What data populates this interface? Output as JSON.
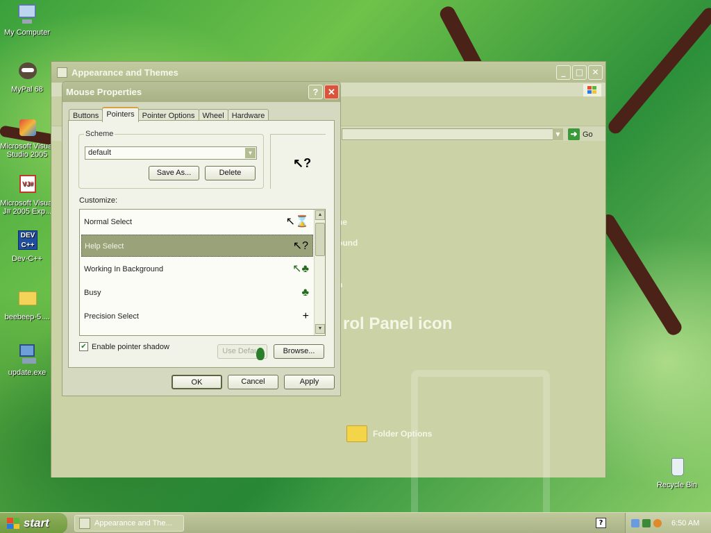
{
  "desktop": {
    "icons": [
      {
        "label": "My Computer",
        "icon": "computer-icon"
      },
      {
        "label": "MyPal 68",
        "icon": "raccoon-icon"
      },
      {
        "label": "Microsoft Visual Studio 2005",
        "icon": "visual-studio-icon"
      },
      {
        "label": "Microsoft Visual J# 2005 Exp...",
        "icon": "visual-j-icon"
      },
      {
        "label": "Dev-C++",
        "icon": "dev-cpp-icon"
      },
      {
        "label": "beebeep-5....",
        "icon": "folder-icon"
      },
      {
        "label": "update.exe",
        "icon": "installer-icon"
      },
      {
        "label": "Recycle Bin",
        "icon": "recycle-bin-icon"
      }
    ]
  },
  "control_panel": {
    "title": "Appearance and Themes",
    "go_label": "Go",
    "partial_texts": [
      "ne",
      "ound",
      "n"
    ],
    "heading_fragment": "rol Panel icon",
    "folder_options": "Folder Options"
  },
  "dialog": {
    "title": "Mouse Properties",
    "help_glyph": "?",
    "close_glyph": "✕",
    "tabs": [
      {
        "label": "Buttons",
        "active": false
      },
      {
        "label": "Pointers",
        "active": true
      },
      {
        "label": "Pointer Options",
        "active": false
      },
      {
        "label": "Wheel",
        "active": false
      },
      {
        "label": "Hardware",
        "active": false
      }
    ],
    "scheme_label": "Scheme",
    "scheme_value": "default",
    "save_as_label": "Save As...",
    "delete_label": "Delete",
    "customize_label": "Customize:",
    "cursors": [
      {
        "label": "Normal Select",
        "glyph": "↖⌛",
        "selected": false
      },
      {
        "label": "Help Select",
        "glyph": "↖?",
        "selected": true
      },
      {
        "label": "Working In Background",
        "glyph": "↖♣",
        "selected": false
      },
      {
        "label": "Busy",
        "glyph": "♣",
        "selected": false
      },
      {
        "label": "Precision Select",
        "glyph": "+",
        "selected": false
      }
    ],
    "shadow_label": "Enable pointer shadow",
    "shadow_checked": true,
    "use_default_label": "Use Default",
    "browse_label": "Browse...",
    "ok_label": "OK",
    "cancel_label": "Cancel",
    "apply_label": "Apply"
  },
  "taskbar": {
    "start_label": "start",
    "task_label": "Appearance and The...",
    "help_glyph": "?",
    "clock": "6:50 AM"
  },
  "colors": {
    "accent": "#9aa27a",
    "close_red": "#d9543a",
    "start_green": "#6f9a40"
  }
}
